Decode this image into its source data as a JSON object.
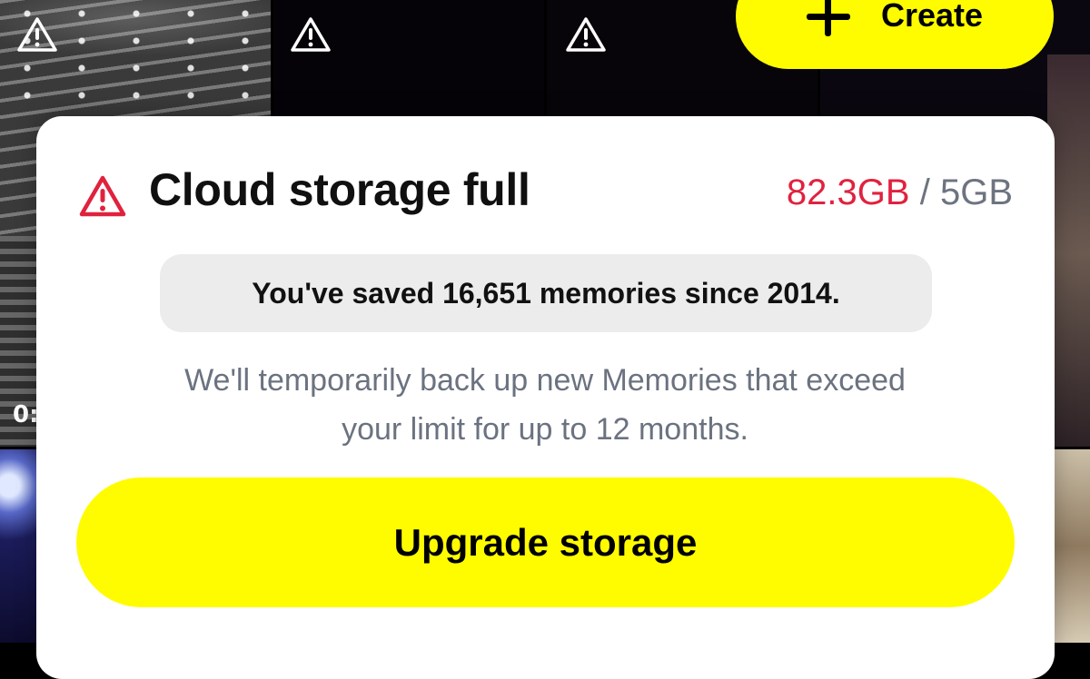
{
  "background": {
    "tiles": [
      {
        "id": "tile-1",
        "warning_icon": "warning-icon"
      },
      {
        "id": "tile-2",
        "warning_icon": "warning-icon"
      },
      {
        "id": "tile-3",
        "warning_icon": "warning-icon"
      }
    ],
    "partial_timestamp": "0:"
  },
  "create_button": {
    "icon": "plus-icon",
    "label": "Create",
    "color": "#fffc00"
  },
  "storage_sheet": {
    "icon": "alert-triangle-icon",
    "title": "Cloud storage full",
    "usage": {
      "used": "82.3GB",
      "separator": "/",
      "limit": "5GB",
      "used_color": "#e0223f",
      "limit_color": "#6d7480"
    },
    "memories_message": "You've saved 16,651 memories since 2014.",
    "description_line1": "We'll temporarily back up new Memories that exceed",
    "description_line2": "your limit for up to 12 months.",
    "upgrade_button_label": "Upgrade storage",
    "button_color": "#fffc00"
  }
}
